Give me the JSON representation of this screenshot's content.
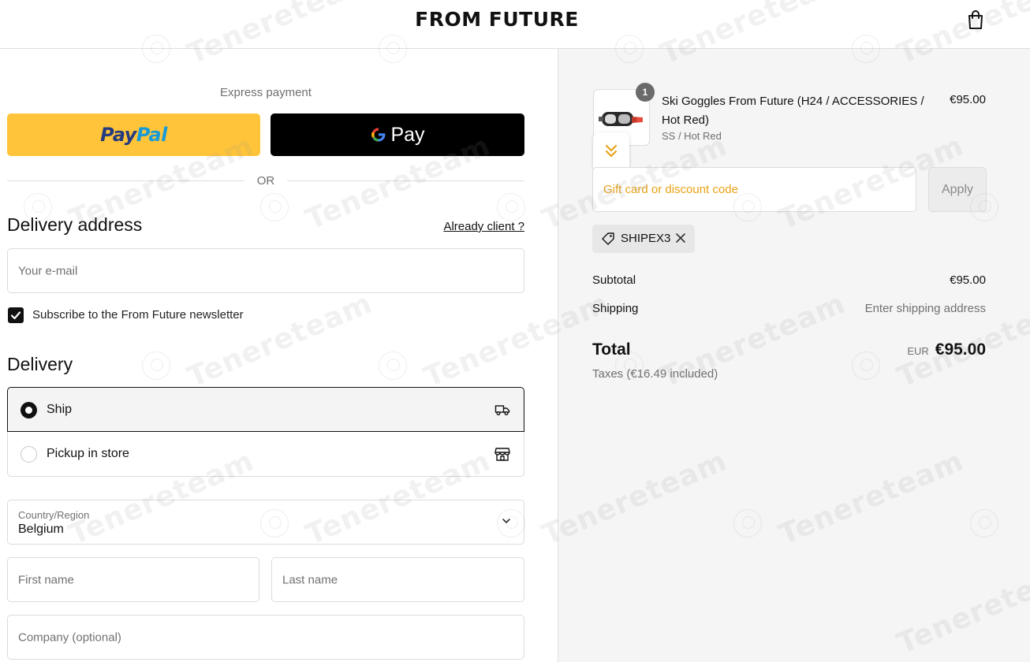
{
  "header": {
    "brand": "FROM FUTURE",
    "cart_icon": "shopping-bag-icon"
  },
  "express": {
    "label": "Express payment",
    "paypal_part1": "Pay",
    "paypal_part2": "Pal",
    "gpay_label": "Pay",
    "divider": "OR"
  },
  "delivery_address": {
    "title": "Delivery address",
    "already_client_link": "Already client ?",
    "email_placeholder": "Your e-mail",
    "newsletter_label": "Subscribe to the From Future newsletter",
    "newsletter_checked": true
  },
  "delivery": {
    "title": "Delivery",
    "options": [
      {
        "label": "Ship",
        "selected": true,
        "icon": "truck-icon"
      },
      {
        "label": "Pickup in store",
        "selected": false,
        "icon": "store-icon"
      }
    ]
  },
  "address": {
    "country_label": "Country/Region",
    "country_value": "Belgium",
    "first_name_placeholder": "First name",
    "last_name_placeholder": "Last name",
    "company_placeholder": "Company (optional)"
  },
  "order": {
    "item": {
      "quantity": "1",
      "title": "Ski Goggles From Future (H24 / ACCESSORIES / Hot Red)",
      "variant": "SS / Hot Red",
      "price": "€95.00"
    },
    "discount_placeholder": "Gift card or discount code",
    "apply_label": "Apply",
    "applied_code": "SHIPEX3",
    "subtotal_label": "Subtotal",
    "subtotal_value": "€95.00",
    "shipping_label": "Shipping",
    "shipping_value": "Enter shipping address",
    "total_label": "Total",
    "total_currency": "EUR",
    "total_value": "€95.00",
    "taxes": "Taxes (€16.49 included)"
  },
  "watermark": {
    "text": "Tenereteam"
  },
  "colors": {
    "paypal_yellow": "#ffc439",
    "paypal_dark_blue": "#253b80",
    "paypal_light_blue": "#179bd7",
    "discount_placeholder": "#e8a317",
    "summary_background": "#f5f5f5"
  }
}
